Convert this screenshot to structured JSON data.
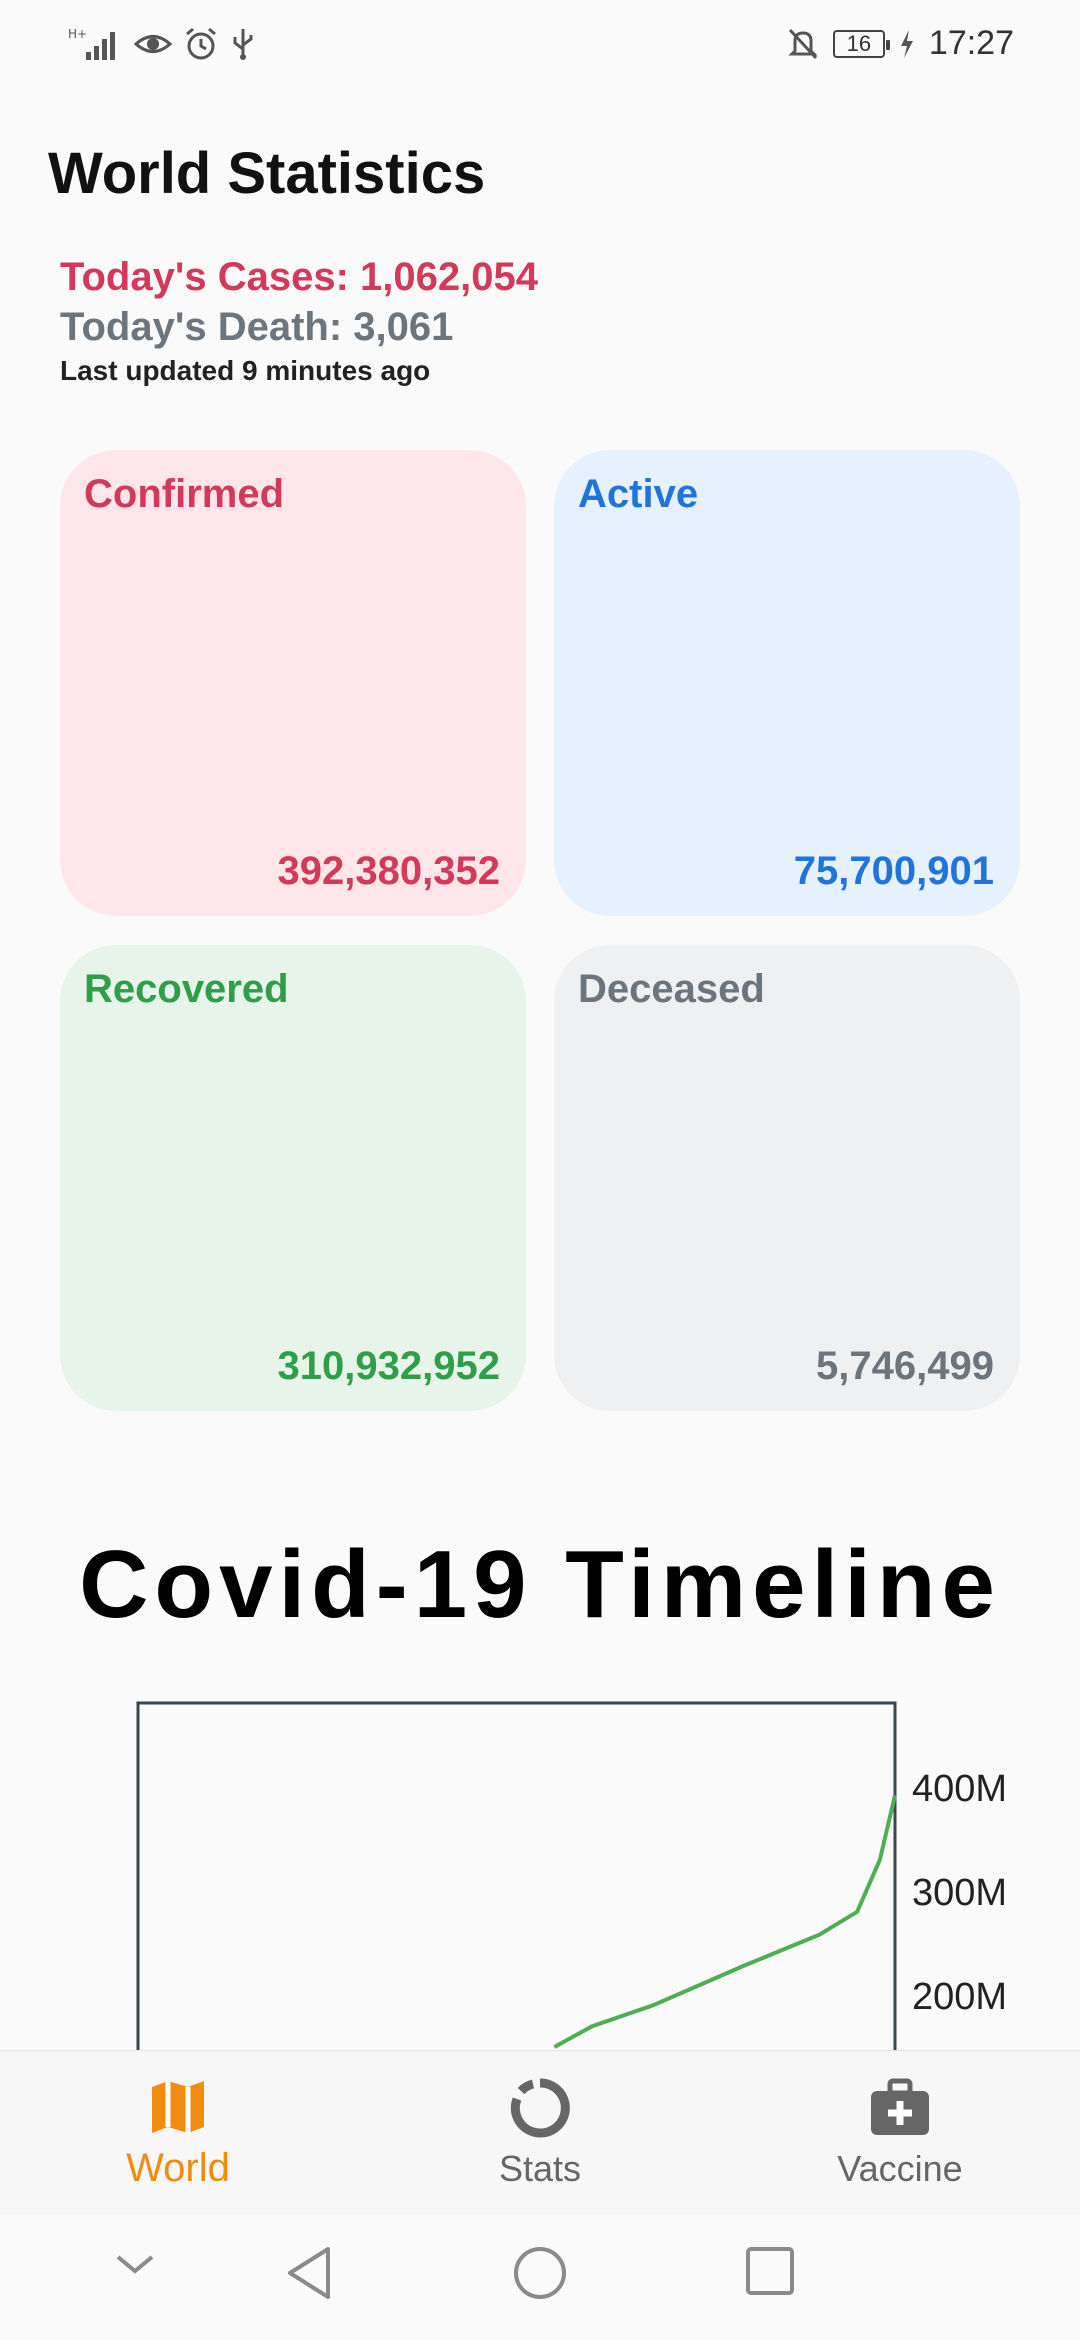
{
  "status_bar": {
    "time": "17:27",
    "battery": "16",
    "icons": [
      "signal-icon",
      "eye-icon",
      "alarm-icon",
      "usb-icon",
      "bell-off-icon",
      "battery-icon",
      "charging-icon"
    ]
  },
  "header": {
    "title": "World Statistics",
    "today_cases": "Today's Cases: 1,062,054",
    "today_death": "Today's Death: 3,061",
    "last_updated": "Last updated 9 minutes ago"
  },
  "cards": {
    "confirmed": {
      "label": "Confirmed",
      "value": "392,380,352"
    },
    "active": {
      "label": "Active",
      "value": "75,700,901"
    },
    "recovered": {
      "label": "Recovered",
      "value": "310,932,952"
    },
    "deceased": {
      "label": "Deceased",
      "value": "5,746,499"
    }
  },
  "timeline": {
    "title": "Covid-19 Timeline"
  },
  "chart_data": {
    "type": "line",
    "title": "",
    "xlabel": "",
    "ylabel": "",
    "y_ticks": [
      "400M",
      "300M",
      "200M"
    ],
    "ylim": [
      150000000,
      420000000
    ],
    "series": [
      {
        "color": "#4caf50",
        "x": [
          0.55,
          0.6,
          0.68,
          0.8,
          0.9,
          0.95,
          0.98,
          1.0
        ],
        "y": [
          150000000,
          170000000,
          190000000,
          228000000,
          258000000,
          280000000,
          330000000,
          392000000
        ]
      }
    ],
    "grid": false
  },
  "bottom_nav": {
    "items": [
      {
        "label": "World",
        "icon": "map-icon",
        "active": true
      },
      {
        "label": "Stats",
        "icon": "donut-icon",
        "active": false
      },
      {
        "label": "Vaccine",
        "icon": "medical-kit-icon",
        "active": false
      }
    ]
  },
  "colors": {
    "confirmed": "#d2395b",
    "active": "#1f74db",
    "recovered": "#2f9e48",
    "deceased": "#6c757d",
    "nav_active": "#f28c10"
  }
}
